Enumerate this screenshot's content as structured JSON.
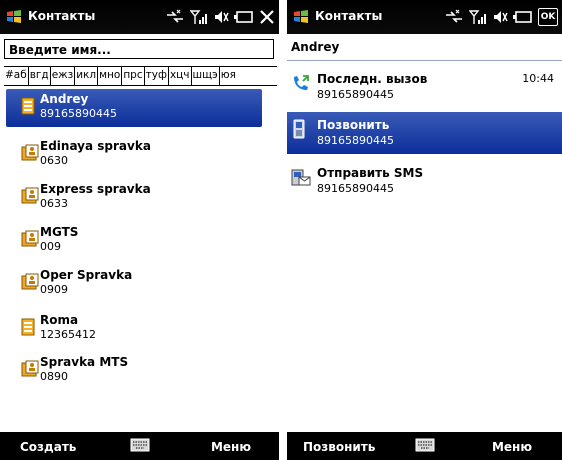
{
  "left": {
    "title": "Контакты",
    "search_placeholder": "Введите имя...",
    "alphabet": [
      "#аб",
      "вгд",
      "ежз",
      "икл",
      "мно",
      "прс",
      "туф",
      "хцч",
      "шщэ",
      "юя"
    ],
    "contacts": [
      {
        "name": "Andrey",
        "number": "89165890445",
        "selected": true,
        "icon": "phone-card-icon"
      },
      {
        "name": "Edinaya spravka",
        "number": "0630",
        "selected": false,
        "icon": "contact-card-icon"
      },
      {
        "name": "Express spravka",
        "number": "0633",
        "selected": false,
        "icon": "contact-card-icon"
      },
      {
        "name": "MGTS",
        "number": "009",
        "selected": false,
        "icon": "contact-card-icon"
      },
      {
        "name": "Oper Spravka",
        "number": "0909",
        "selected": false,
        "icon": "contact-card-icon"
      },
      {
        "name": "Roma",
        "number": "12365412",
        "selected": false,
        "icon": "phone-card-icon"
      },
      {
        "name": "Spravka MTS",
        "number": "0890",
        "selected": false,
        "icon": "contact-card-icon"
      }
    ],
    "softkeys": {
      "left": "Создать",
      "right": "Меню"
    }
  },
  "right": {
    "title": "Контакты",
    "contact_name": "Andrey",
    "actions": [
      {
        "label": "Последн. вызов",
        "number": "89165890445",
        "time": "10:44",
        "icon": "call-log-icon",
        "selected": false
      },
      {
        "label": "Позвонить",
        "number": "89165890445",
        "time": "",
        "icon": "mobile-phone-icon",
        "selected": true
      },
      {
        "label": "Отправить SMS",
        "number": "89165890445",
        "time": "",
        "icon": "sms-icon",
        "selected": false
      }
    ],
    "ok_label": "OK",
    "softkeys": {
      "left": "Позвонить",
      "right": "Меню"
    }
  },
  "colors": {
    "selection": "#1a3ea8",
    "titlebar": "#000000",
    "softbar": "#000000",
    "contact_icon": "#e89a1a"
  }
}
